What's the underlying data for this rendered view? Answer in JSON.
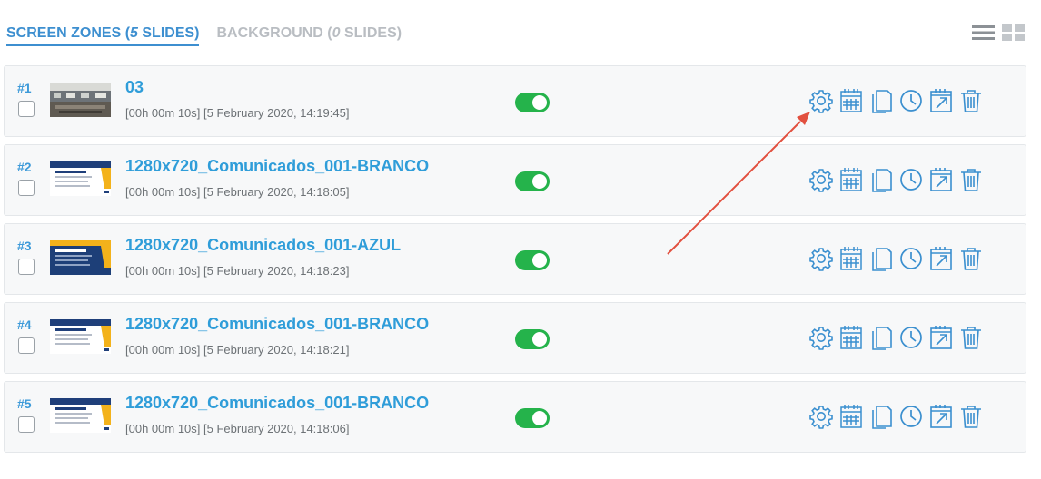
{
  "tabs": [
    {
      "prefix": "SCREEN ZONES (",
      "count": "5",
      "suffix": " SLIDES)",
      "active": true
    },
    {
      "prefix": "BACKGROUND (",
      "count": "0",
      "suffix": " SLIDES)",
      "active": false
    }
  ],
  "slides": [
    {
      "num": "#1",
      "title": "03",
      "meta": "[00h 00m 10s] [5 February 2020, 14:19:45]",
      "enabled": true,
      "thumb": "photo"
    },
    {
      "num": "#2",
      "title": "1280x720_Comunicados_001-BRANCO",
      "meta": "[00h 00m 10s] [5 February 2020, 14:18:05]",
      "enabled": true,
      "thumb": "white"
    },
    {
      "num": "#3",
      "title": "1280x720_Comunicados_001-AZUL",
      "meta": "[00h 00m 10s] [5 February 2020, 14:18:23]",
      "enabled": true,
      "thumb": "blue"
    },
    {
      "num": "#4",
      "title": "1280x720_Comunicados_001-BRANCO",
      "meta": "[00h 00m 10s] [5 February 2020, 14:18:21]",
      "enabled": true,
      "thumb": "white"
    },
    {
      "num": "#5",
      "title": "1280x720_Comunicados_001-BRANCO",
      "meta": "[00h 00m 10s] [5 February 2020, 14:18:06]",
      "enabled": true,
      "thumb": "white"
    }
  ],
  "row_actions": [
    "gear-icon",
    "calendar-icon",
    "copy-icon",
    "clock-icon",
    "export-icon",
    "trash-icon"
  ],
  "view_modes": [
    "list-view-icon",
    "grid-view-icon"
  ],
  "colors": {
    "accent": "#3d8fd0",
    "title": "#2f9dd9",
    "toggle_on": "#25b34b",
    "annotation_arrow": "#e2503f"
  }
}
